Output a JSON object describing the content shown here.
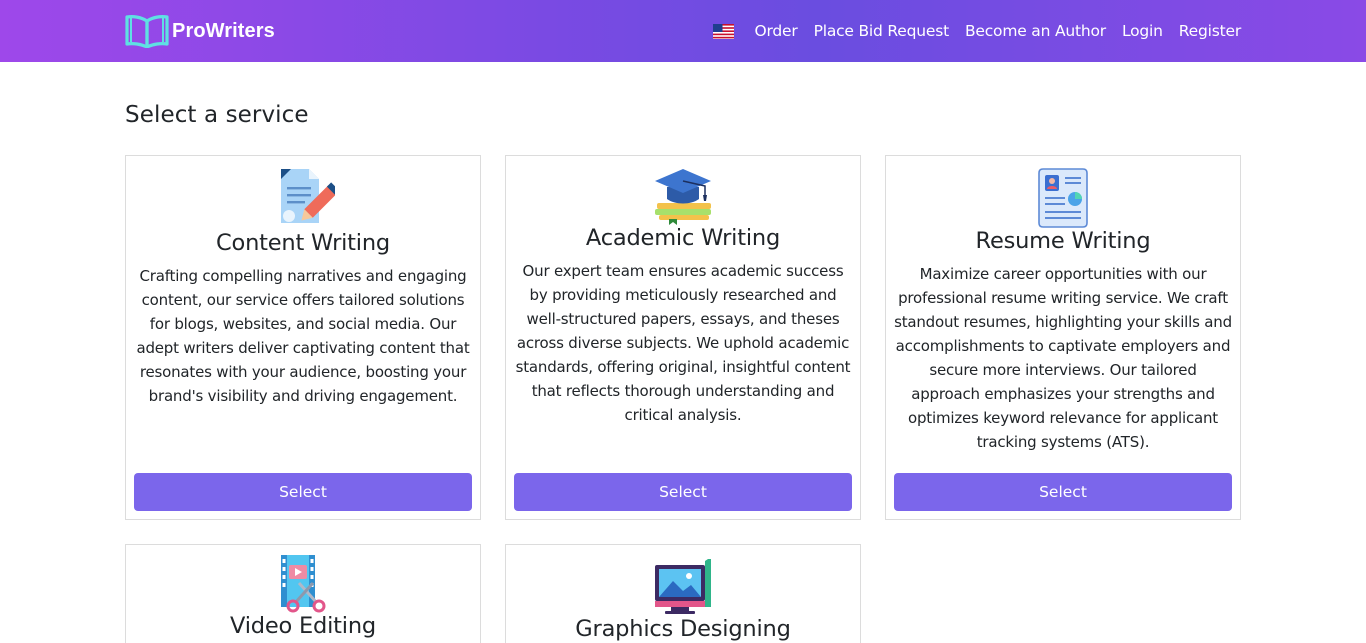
{
  "nav": {
    "brand": "ProWriters",
    "flag_icon": "us-flag-icon",
    "links": [
      "Order",
      "Place Bid Request",
      "Become an Author",
      "Login",
      "Register"
    ]
  },
  "page": {
    "title": "Select a service"
  },
  "services": [
    {
      "icon": "document-pencil-icon",
      "title": "Content Writing",
      "description": "Crafting compelling narratives and engaging content, our service offers tailored solutions for blogs, websites, and social media. Our adept writers deliver captivating content that resonates with your audience, boosting your brand's visibility and driving engagement.",
      "button": "Select"
    },
    {
      "icon": "graduation-cap-books-icon",
      "title": "Academic Writing",
      "description": "Our expert team ensures academic success by providing meticulously researched and well-structured papers, essays, and theses across diverse subjects. We uphold academic standards, offering original, insightful content that reflects thorough understanding and critical analysis.",
      "button": "Select"
    },
    {
      "icon": "resume-document-icon",
      "title": "Resume Writing",
      "description": "Maximize career opportunities with our professional resume writing service. We craft standout resumes, highlighting your skills and accomplishments to captivate employers and secure more interviews. Our tailored approach emphasizes your strengths and optimizes keyword relevance for applicant tracking systems (ATS).",
      "button": "Select"
    },
    {
      "icon": "film-scissors-icon",
      "title": "Video Editing"
    },
    {
      "icon": "monitor-image-icon",
      "title": "Graphics Designing"
    }
  ],
  "colors": {
    "navbar_gradient_start": "#9e48ea",
    "navbar_gradient_mid": "#6a4de0",
    "button": "#7b66eb",
    "brand_icon": "#5fe0e3"
  }
}
